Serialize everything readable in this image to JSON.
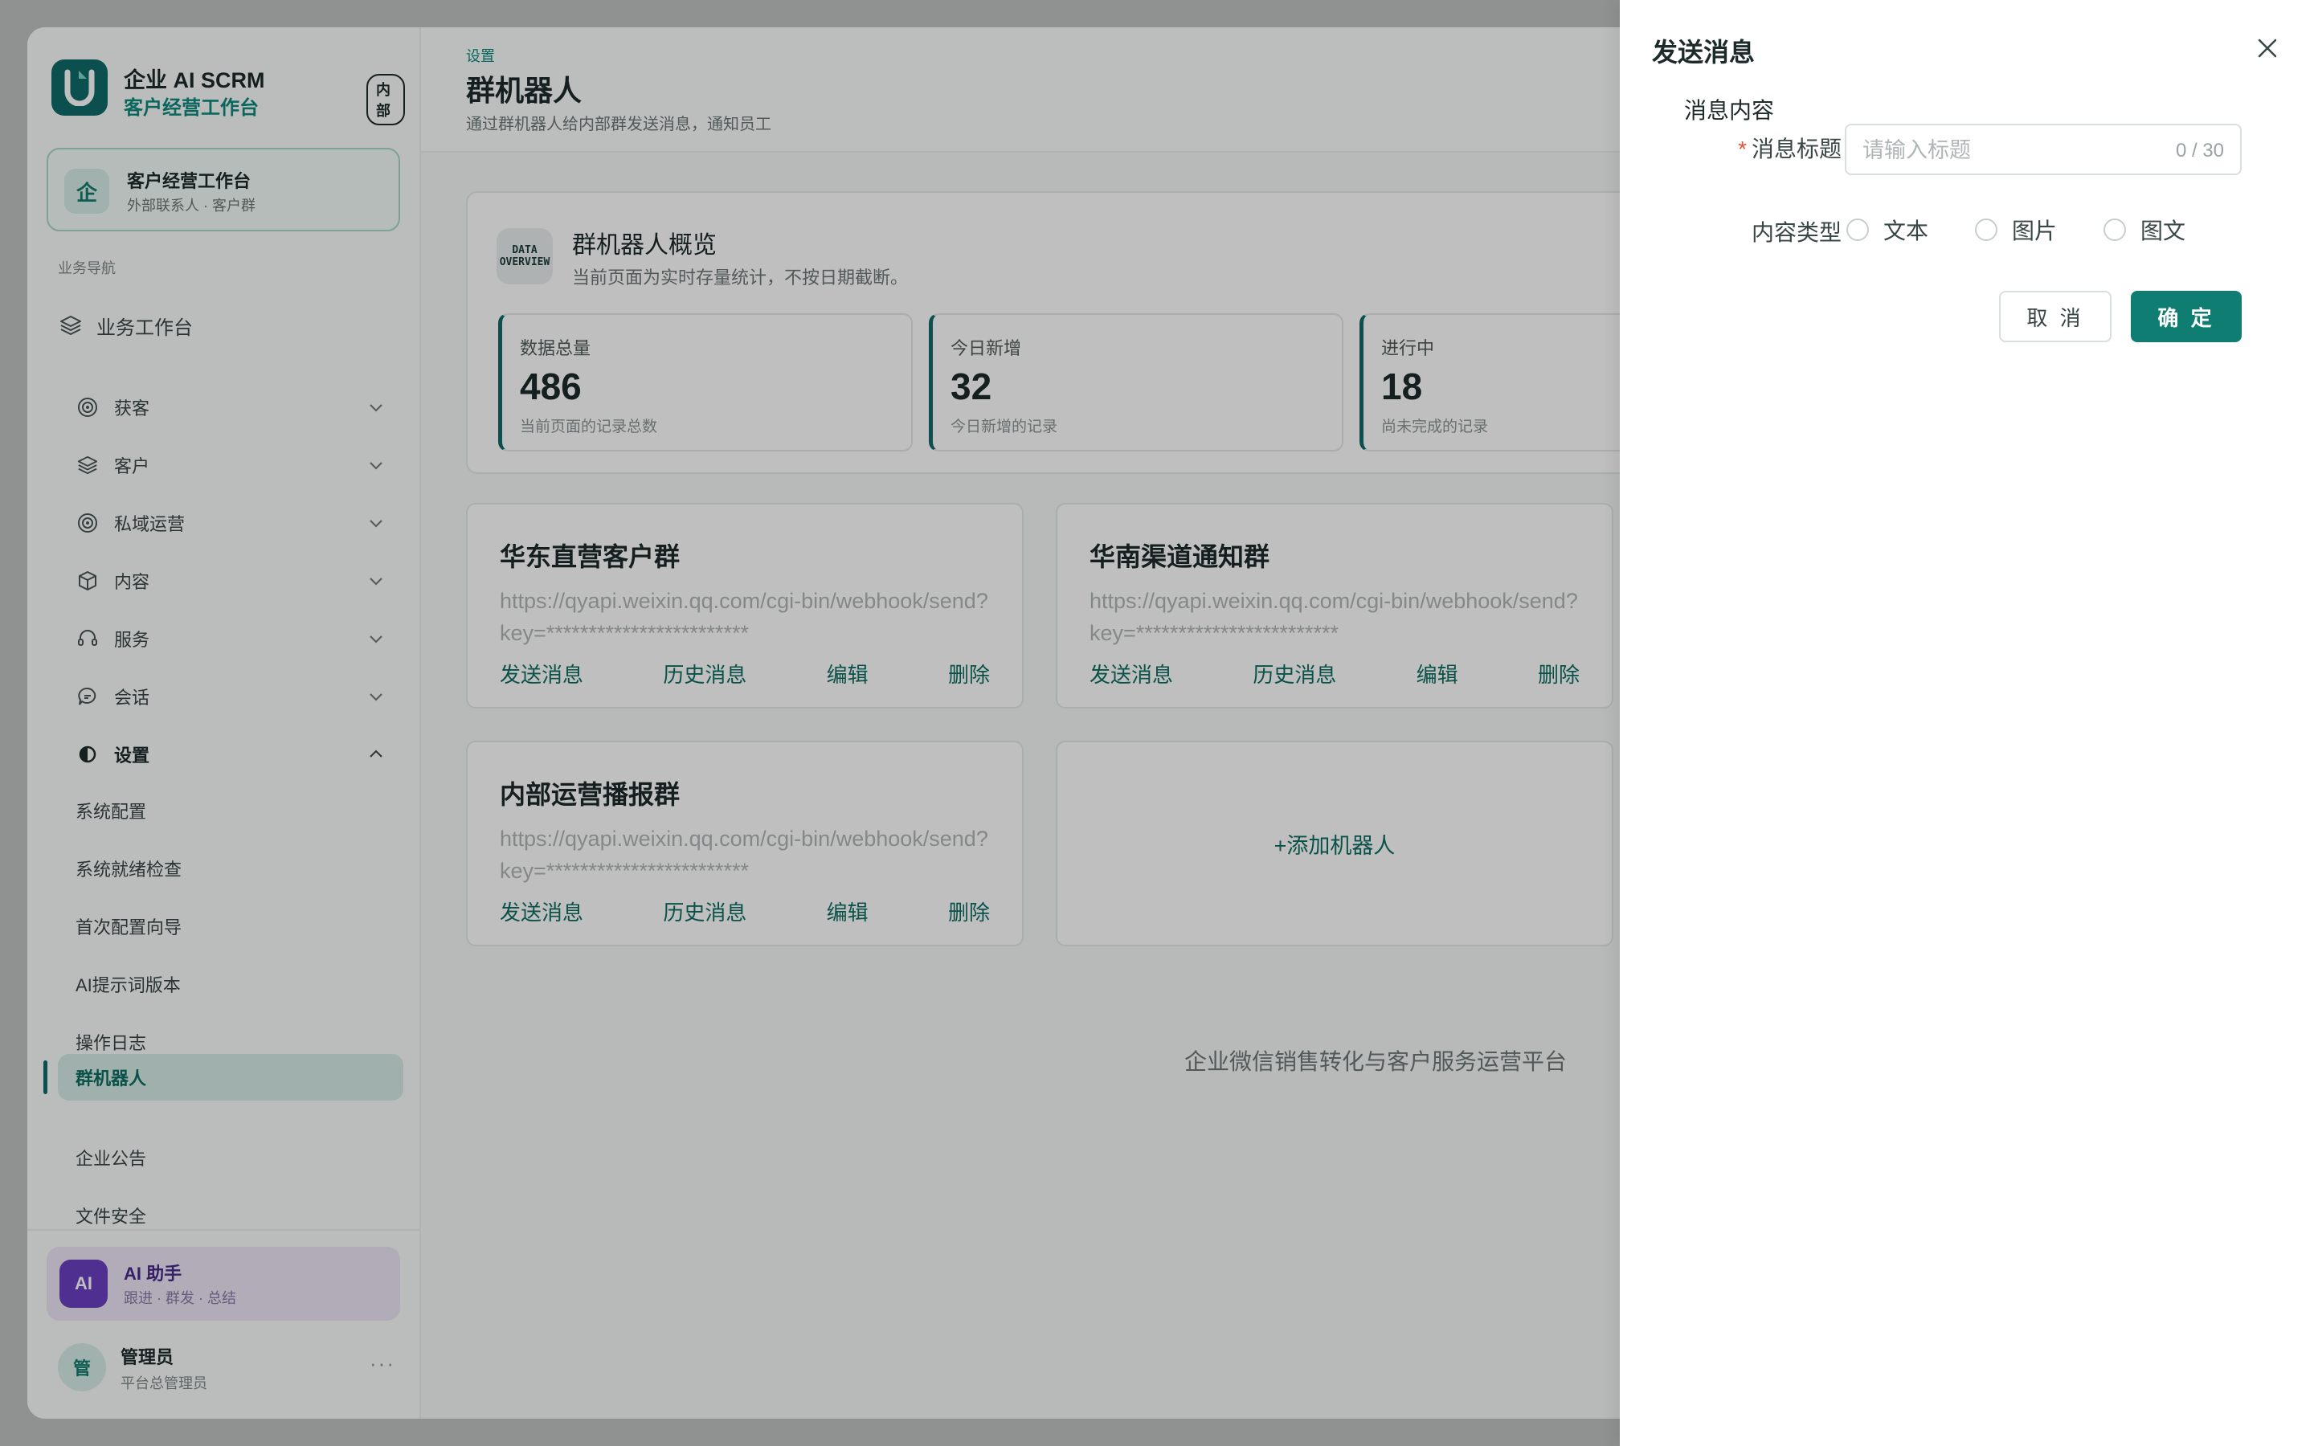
{
  "brand": {
    "name": "企业 AI SCRM",
    "subtitle": "客户经营工作台",
    "tag": "内部"
  },
  "workspace": {
    "icon_text": "企",
    "title": "客户经营工作台",
    "subtitle": "外部联系人 · 客户群"
  },
  "nav": {
    "section_label": "业务导航",
    "top_item": {
      "label": "业务工作台",
      "icon": "layers-icon"
    },
    "groups": [
      {
        "label": "获客",
        "icon": "target-icon"
      },
      {
        "label": "客户",
        "icon": "layers-icon"
      },
      {
        "label": "私域运营",
        "icon": "target-icon"
      },
      {
        "label": "内容",
        "icon": "box-icon"
      },
      {
        "label": "服务",
        "icon": "headset-icon"
      },
      {
        "label": "会话",
        "icon": "chat-icon"
      },
      {
        "label": "设置",
        "icon": "settings-icon"
      }
    ],
    "settings_items": [
      "系统配置",
      "系统就绪检查",
      "首次配置向导",
      "AI提示词版本",
      "操作日志",
      "群机器人",
      "企业公告",
      "文件安全"
    ],
    "active_item": "群机器人"
  },
  "assistant": {
    "badge": "AI",
    "title": "AI 助手",
    "subtitle": "跟进 · 群发 · 总结"
  },
  "user": {
    "avatar": "管",
    "name": "管理员",
    "role": "平台总管理员",
    "more": "···"
  },
  "header": {
    "breadcrumb": "设置",
    "title": "群机器人",
    "description": "通过群机器人给内部群发送消息，通知员工"
  },
  "overview": {
    "icon_lines": [
      "DATA",
      "OVERVIEW"
    ],
    "title": "群机器人概览",
    "subtitle": "当前页面为实时存量统计，不按日期截断。",
    "stats": [
      {
        "label": "数据总量",
        "value": "486",
        "note": "当前页面的记录总数"
      },
      {
        "label": "今日新增",
        "value": "32",
        "note": "今日新增的记录"
      },
      {
        "label": "进行中",
        "value": "18",
        "note": "尚未完成的记录"
      }
    ]
  },
  "robots": [
    {
      "name": "华东直营客户群",
      "url": "https://qyapi.weixin.qq.com/cgi-bin/webhook/send?key=************************",
      "actions": [
        "发送消息",
        "历史消息",
        "编辑",
        "删除"
      ]
    },
    {
      "name": "华南渠道通知群",
      "url": "https://qyapi.weixin.qq.com/cgi-bin/webhook/send?key=************************",
      "actions": [
        "发送消息",
        "历史消息",
        "编辑",
        "删除"
      ]
    },
    {
      "name": "内部运营播报群",
      "url": "https://qyapi.weixin.qq.com/cgi-bin/webhook/send?key=************************",
      "actions": [
        "发送消息",
        "历史消息",
        "编辑",
        "删除"
      ]
    }
  ],
  "add_robot_label": "+添加机器人",
  "footer_text": "企业微信销售转化与客户服务运营平台",
  "drawer": {
    "title": "发送消息",
    "section_title": "消息内容",
    "title_field": {
      "required_mark": "*",
      "label": "消息标题",
      "placeholder": "请输入标题",
      "value": "",
      "counter": "0 / 30"
    },
    "type_field": {
      "label": "内容类型",
      "options": [
        "文本",
        "图片",
        "图文"
      ]
    },
    "cancel_label": "取 消",
    "ok_label": "确 定"
  },
  "colors": {
    "primary": "#0f6a6a",
    "accent": "#0e8a7e",
    "button": "#0f7d72",
    "assistant": "#6a3fc0"
  }
}
